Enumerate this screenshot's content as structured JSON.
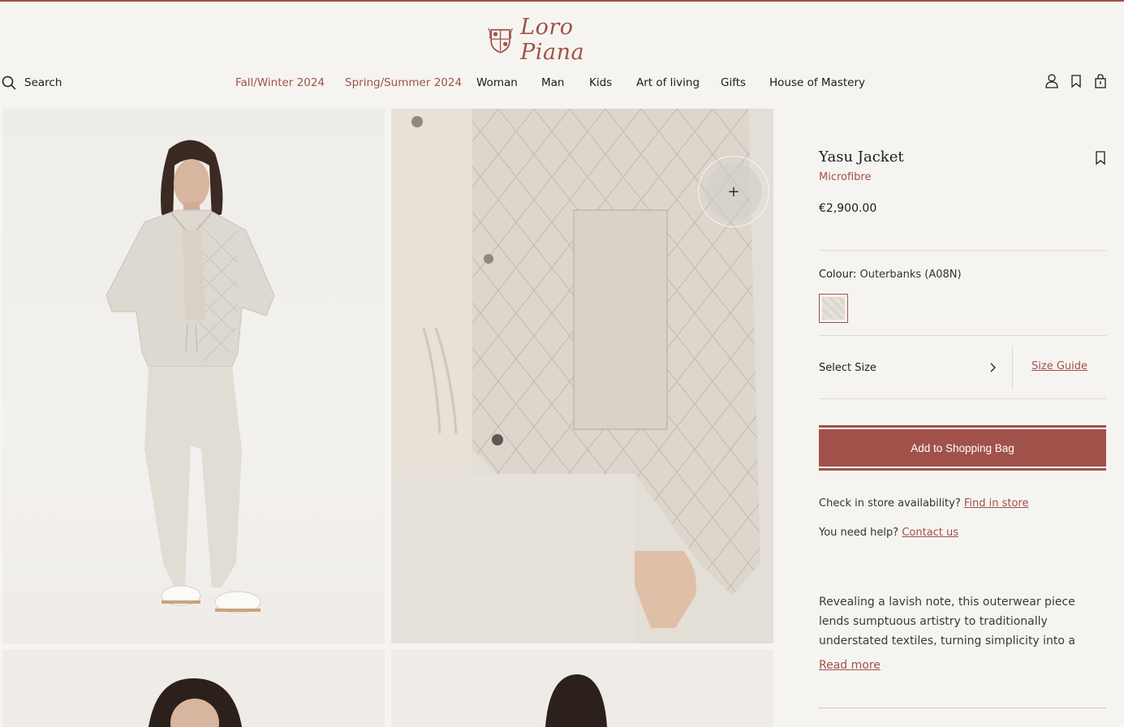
{
  "header": {
    "brand": "Loro Piana",
    "search_label": "Search",
    "nav": [
      {
        "label": "Fall/Winter 2024",
        "accent": true
      },
      {
        "label": "Spring/Summer 2024",
        "accent": true
      },
      {
        "label": "Woman",
        "accent": false
      },
      {
        "label": "Man",
        "accent": false
      },
      {
        "label": "Kids",
        "accent": false
      },
      {
        "label": "Art of living",
        "accent": false
      },
      {
        "label": "Gifts",
        "accent": false
      },
      {
        "label": "House of Mastery",
        "accent": false
      }
    ],
    "icons": [
      "account-icon",
      "wishlist-icon",
      "shopping-bag-icon"
    ]
  },
  "product": {
    "name": "Yasu Jacket",
    "material": "Microfibre",
    "price": "€2,900.00",
    "colour_label": "Colour:",
    "colour_value": "Outerbanks (A08N)",
    "size_label": "Select Size",
    "size_guide": "Size Guide",
    "add_to_bag": "Add to Shopping Bag",
    "store_question": "Check in store availability?",
    "store_link": "Find in store",
    "help_question": "You need help?",
    "help_link": "Contact us",
    "description": "Revealing a lavish note, this outerwear piece lends sumptuous artistry to traditionally understated textiles, turning simplicity into a canvas for luxurio…",
    "read_more": "Read more"
  },
  "colors": {
    "accent": "#a0524a",
    "background": "#f6f4f1"
  }
}
